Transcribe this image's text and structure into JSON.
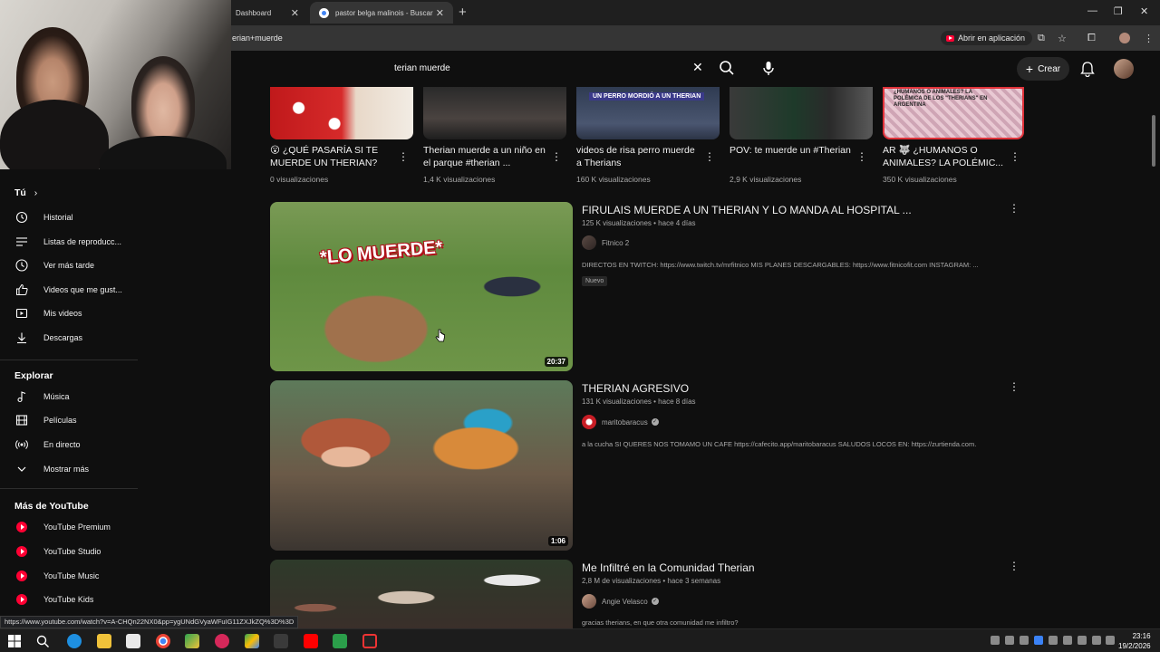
{
  "browser": {
    "tabs": [
      {
        "label": "Dashboard"
      },
      {
        "label": "pastor belga malinois - Buscar"
      }
    ],
    "url": "erian+muerde",
    "open_in_app": "Abrir en aplicación",
    "status_url": "https://www.youtube.com/watch?v=A-CHQn22NX0&pp=ygUNdGVyaWFuIG11ZXJkZQ%3D%3D"
  },
  "masthead": {
    "search_query": "terian muerde",
    "create_label": "Crear"
  },
  "sidebar": {
    "you_heading": "Tú",
    "you_items": [
      {
        "label": "Historial",
        "icon": "history-icon"
      },
      {
        "label": "Listas de reproducc...",
        "icon": "playlists-icon"
      },
      {
        "label": "Ver más tarde",
        "icon": "watch-later-icon"
      },
      {
        "label": "Videos que me gust...",
        "icon": "thumbs-up-icon"
      },
      {
        "label": "Mis videos",
        "icon": "my-videos-icon"
      },
      {
        "label": "Descargas",
        "icon": "download-icon"
      }
    ],
    "explore_heading": "Explorar",
    "explore_items": [
      {
        "label": "Música",
        "icon": "music-icon"
      },
      {
        "label": "Películas",
        "icon": "movies-icon"
      },
      {
        "label": "En directo",
        "icon": "live-icon"
      },
      {
        "label": "Mostrar más",
        "icon": "chevron-down-icon"
      }
    ],
    "more_heading": "Más de YouTube",
    "more_items": [
      {
        "label": "YouTube Premium"
      },
      {
        "label": "YouTube Studio"
      },
      {
        "label": "YouTube Music"
      },
      {
        "label": "YouTube Kids"
      }
    ]
  },
  "shelf": [
    {
      "title": "😮 ¿QUÉ PASARÍA SI TE MUERDE UN THERIAN?",
      "views": "0 visualizaciones"
    },
    {
      "title": "Therian muerde a un niño en el parque #therian ...",
      "views": "1,4 K visualizaciones",
      "thumb_text": ""
    },
    {
      "title": "videos de risa perro muerde a Therians",
      "views": "160 K visualizaciones",
      "thumb_text": "UN PERRO MORDIÓ A UN THERIAN"
    },
    {
      "title": "POV: te muerde un #Therian",
      "views": "2,9 K visualizaciones"
    },
    {
      "title": "AR 🐺 ¿HUMANOS O ANIMALES? LA POLÉMIC...",
      "views": "350 K visualizaciones",
      "thumb_text": "¿HUMANOS O ANIMALES? LA POLÉMICA DE LOS \"THERIANS\" EN ARGENTINA"
    }
  ],
  "results": [
    {
      "title": "FIRULAIS MUERDE A UN THERIAN Y LO MANDA AL HOSPITAL ...",
      "meta": "125 K visualizaciones • hace 4 días",
      "channel": "Fitnico 2",
      "description": "DIRECTOS EN TWITCH: https://www.twitch.tv/mrfitnico MIS PLANES DESCARGABLES: https://www.fitnicofit.com INSTAGRAM: ...",
      "badge": "Nuevo",
      "duration": "20:37",
      "thumb_text": "*LO MUERDE*"
    },
    {
      "title": "THERIAN AGRESIVO",
      "meta": "131 K visualizaciones • hace 8 días",
      "channel": "maritobaracus",
      "description": "a la cucha SI QUERES NOS TOMAMO UN CAFE https://cafecito.app/maritobaracus SALUDOS LOCOS EN: https://zurtienda.com.",
      "duration": "1:06"
    },
    {
      "title": "Me Infiltré en la Comunidad Therian",
      "meta": "2,8 M de visualizaciones • hace 3 semanas",
      "channel": "Angie Velasco",
      "description": "gracias therians, en que otra comunidad me infiltro?"
    }
  ],
  "taskbar": {
    "time": "23:16",
    "date": "19/2/2026"
  },
  "colors": {
    "background": "#0f0f0f",
    "accent_red": "#ff0033",
    "secondary_text": "#aaaaaa"
  }
}
